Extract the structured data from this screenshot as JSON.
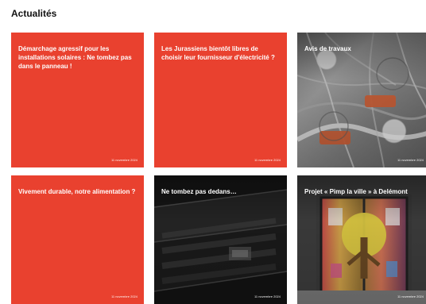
{
  "section": {
    "title": "Actualités"
  },
  "cards": [
    {
      "title": "Démarchage agressif pour les installations solaires : Ne tombez pas dans le panneau !",
      "date": "11 novembre 2024"
    },
    {
      "title": "Les Jurassiens bientôt libres de choisir leur fournisseur d'électricité ?",
      "date": "11 novembre 2024"
    },
    {
      "title": "Avis de travaux",
      "date": "11 novembre 2024"
    },
    {
      "title": "Vivement durable, notre alimentation ?",
      "date": "11 novembre 2024"
    },
    {
      "title": "Ne tombez pas dedans…",
      "date": "11 novembre 2024"
    },
    {
      "title": "Projet « Pimp la ville » à Delémont",
      "date": "11 novembre 2024"
    }
  ],
  "colors": {
    "card_red": "#e9412f",
    "title_text": "#111111",
    "card_text": "#ffffff"
  }
}
